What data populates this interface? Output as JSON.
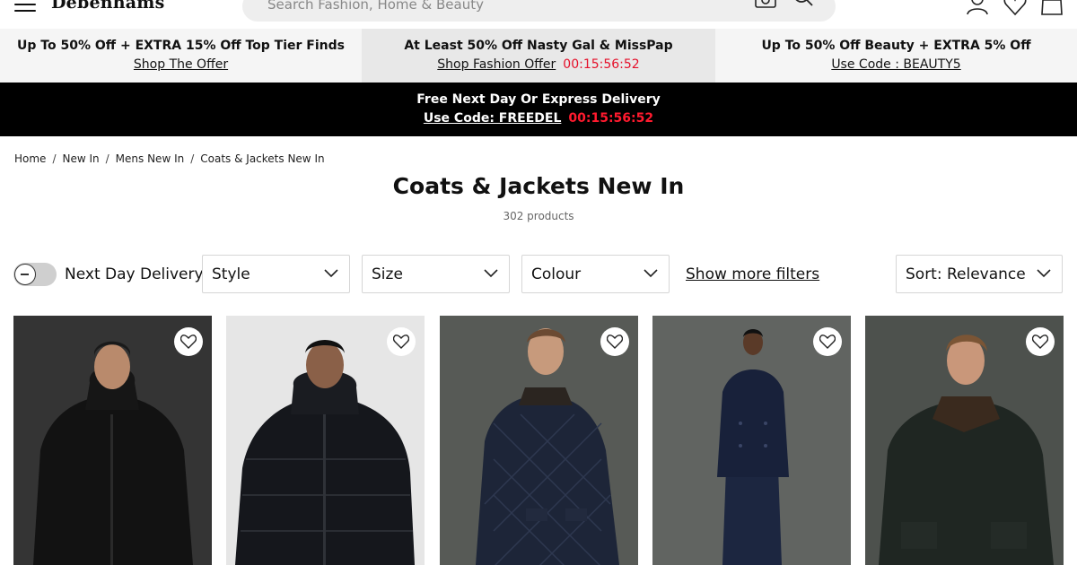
{
  "header": {
    "logo": "Debenhams",
    "search_placeholder": "Search Fashion, Home & Beauty"
  },
  "promos": [
    {
      "title": "Up To 50% Off + EXTRA 15% Off Top Tier Finds",
      "link": "Shop The Offer",
      "timer": ""
    },
    {
      "title": "At Least 50% Off Nasty Gal & MissPap",
      "link": "Shop Fashion Offer",
      "timer": "00:15:56:52"
    },
    {
      "title": "Up To 50% Off Beauty + EXTRA 5% Off",
      "link": "Use Code : BEAUTY5",
      "timer": ""
    }
  ],
  "delivery": {
    "title": "Free Next Day Or Express Delivery",
    "link": "Use Code: FREEDEL",
    "timer": "00:15:56:52"
  },
  "breadcrumb": [
    "Home",
    "New In",
    "Mens New In",
    "Coats & Jackets New In"
  ],
  "page": {
    "title": "Coats & Jackets New In",
    "count": "302 products"
  },
  "filters": {
    "toggle_label": "Next Day Delivery",
    "style": "Style",
    "size": "Size",
    "colour": "Colour",
    "more": "Show more filters",
    "sort": "Sort: Relevance"
  },
  "colors": {
    "promo_timer": "#e5102a",
    "delivery_bg": "#000000"
  },
  "products": [
    {
      "icon": "heart-icon",
      "image": "man-in-black-hooded-parka"
    },
    {
      "icon": "heart-icon",
      "image": "man-in-black-puffer-jacket"
    },
    {
      "icon": "heart-icon",
      "image": "man-in-navy-quilted-jacket"
    },
    {
      "icon": "heart-icon",
      "image": "man-in-navy-peacoat"
    },
    {
      "icon": "heart-icon",
      "image": "man-in-dark-wax-jacket"
    }
  ]
}
